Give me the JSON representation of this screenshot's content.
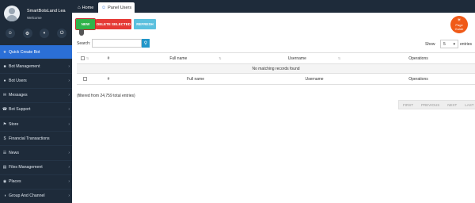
{
  "profile": {
    "name": "SmartBotsLand Lea",
    "welcome": "Welcome"
  },
  "quick_icons": [
    "user-icon",
    "settings-icon",
    "gauge-icon",
    "power-icon"
  ],
  "menu": [
    {
      "label": "Quick Create Bot",
      "icon": "star-icon",
      "active": true
    },
    {
      "label": "Bot Management",
      "icon": "robot-icon"
    },
    {
      "label": "Bot Users",
      "icon": "users-icon"
    },
    {
      "label": "Messages",
      "icon": "envelope-icon"
    },
    {
      "label": "Bot Support",
      "icon": "headset-icon"
    },
    {
      "label": "Store",
      "icon": "store-icon"
    },
    {
      "label": "Financial Transactions",
      "icon": "money-icon"
    },
    {
      "label": "News",
      "icon": "news-icon"
    },
    {
      "label": "Files Management",
      "icon": "folder-icon"
    },
    {
      "label": "Places",
      "icon": "map-pin-icon"
    },
    {
      "label": "Group And Channel",
      "icon": "group-icon"
    }
  ],
  "tabs": {
    "home": "Home",
    "panel_users": "Panel Users"
  },
  "toolbar": {
    "new": "NEW",
    "delete_selected": "DELETE SELECTED",
    "refresh": "REFRESH"
  },
  "guide": {
    "line1": "Page",
    "line2": "Guide"
  },
  "search": {
    "label": "Search:",
    "value": ""
  },
  "show": {
    "label": "Show",
    "value": "5",
    "suffix": "entries"
  },
  "table": {
    "columns": [
      "#",
      "Full name",
      "Username",
      "Operations"
    ],
    "empty_message": "No matching records found"
  },
  "info": "(filtered from 24,759 total entries)",
  "pagination": [
    "FIRST",
    "PREVIOUS",
    "NEXT",
    "LAST"
  ],
  "colors": {
    "sidebar": "#1e2b3a",
    "active": "#2b6fd6",
    "new": "#2fb34a",
    "delete": "#e53935",
    "refresh": "#5bc0de",
    "guide": "#f05a18"
  }
}
